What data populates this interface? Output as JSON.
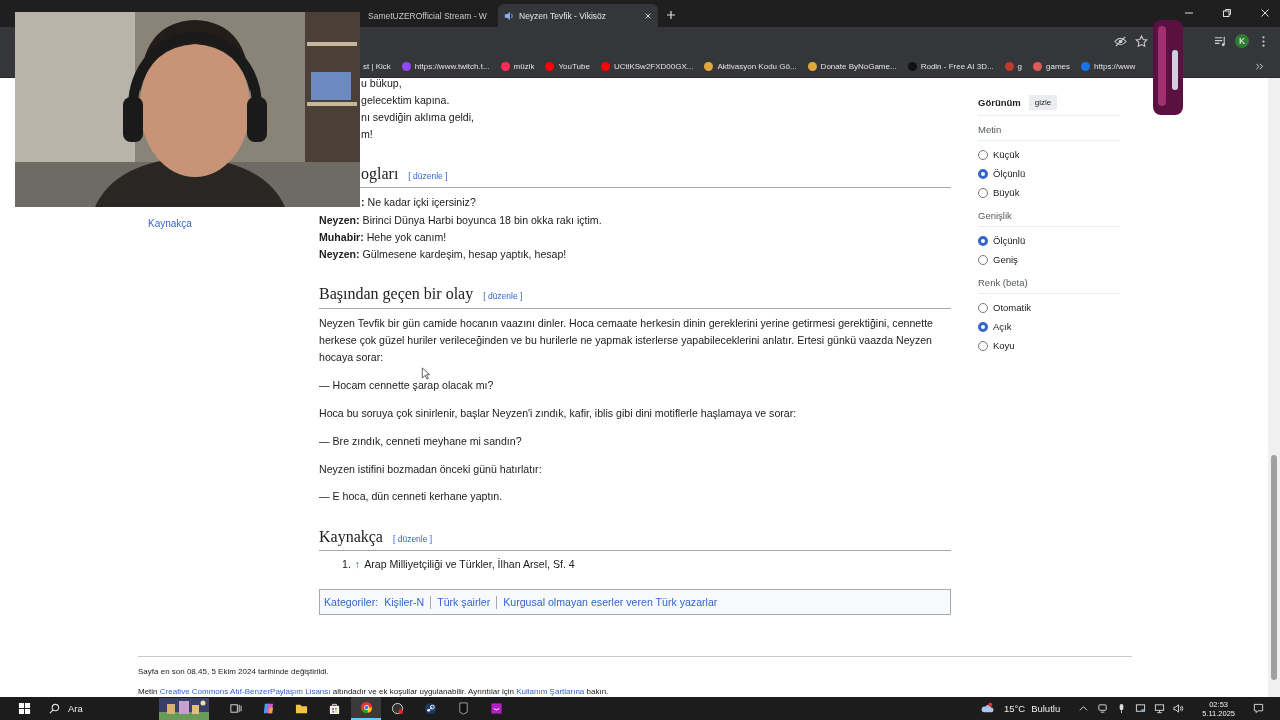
{
  "tabs": [
    {
      "label": "SametUZEROfficial Stream - W",
      "selected": false
    },
    {
      "label": "Neyzen Tevfik - Vikisöz",
      "selected": true
    }
  ],
  "profile_initial": "K",
  "bookmarks": [
    {
      "label": "st | Kick"
    },
    {
      "label": "https://www.twitch.t...",
      "color": "#9146ff"
    },
    {
      "label": "müzik",
      "color": "#ff2d55"
    },
    {
      "label": "YouTube",
      "color": "#ff0000"
    },
    {
      "label": "UCtlKSw2FXD00GX...",
      "color": "#ff0000"
    },
    {
      "label": "Aktivasyon Kodu Gö...",
      "color": "#e0a83a"
    },
    {
      "label": "Donate ByNoGame...",
      "color": "#e0a83a"
    },
    {
      "label": "Rodin - Free AI 3D...",
      "color": "#111111"
    },
    {
      "label": "g",
      "color": "#c0392b"
    },
    {
      "label": "games",
      "color": "#e05a5a"
    },
    {
      "label": "https://www",
      "color": "#1a73e8"
    }
  ],
  "toc": [
    {
      "label": "Kaynakça"
    }
  ],
  "poem_lines": [
    "u bükup,",
    "gelecektim kapına.",
    "nı sevdiğin aklıma geldi,",
    "m!"
  ],
  "sections": [
    {
      "heading": "ogları",
      "edit": "[ düzenle ]",
      "blocks": [
        {
          "kind": "line",
          "text": "**:** Ne kadar içki içersiniz?"
        },
        {
          "kind": "line",
          "text": "**Neyzen:** Birinci Dünya Harbi boyunca 18 bin okka rakı içtim."
        },
        {
          "kind": "line",
          "text": "**Muhabir:** Hehe yok canım!"
        },
        {
          "kind": "line",
          "text": "**Neyzen:** Gülmesene kardeşim, hesap yaptık, hesap!"
        }
      ]
    },
    {
      "heading": "Başından geçen bir olay",
      "edit": "[ düzenle ]",
      "blocks": [
        {
          "kind": "para",
          "text": "Neyzen Tevfik bir gün camide hocanın vaazını dinler. Hoca cemaate herkesin dinin gereklerini yerine getirmesi gerektiğini, cennette herkese çok güzel huriler verileceğinden ve bu hurilerle ne yapmak isterlerse yapabileceklerini anlatır. Ertesi günkü vaazda Neyzen hocaya sorar:"
        },
        {
          "kind": "para",
          "text": "— Hocam cennette şarap olacak mı?"
        },
        {
          "kind": "para",
          "text": "Hoca bu soruya çok sinirlenir, başlar Neyzen'i zındık, kafir, iblis gibi dini motiflerle haşlamaya ve sorar:"
        },
        {
          "kind": "para",
          "text": "— Bre zındık, cenneti meyhane mi sandın?"
        },
        {
          "kind": "para",
          "text": "Neyzen istifini bozmadan önceki günü hatırlatır:"
        },
        {
          "kind": "para",
          "text": "— E hoca, dün cenneti kerhane yaptın."
        }
      ]
    },
    {
      "heading": "Kaynakça",
      "edit": "[ düzenle ]",
      "blocks": [
        {
          "kind": "reference",
          "number": "1.",
          "arrow": "↑",
          "text": "Arap Milliyetçiliği ve Türkler, İlhan Arsel, Sf. 4"
        }
      ]
    }
  ],
  "categories": {
    "label": "Kategoriler:",
    "items": [
      "Kişiler-N",
      "Türk şairler",
      "Kurgusal olmayan eserler veren Türk yazarlar"
    ]
  },
  "appearance": {
    "title": "Görünüm",
    "hide_button": "gizle",
    "groups": [
      {
        "label": "Metin",
        "options": [
          {
            "label": "Küçük",
            "selected": false
          },
          {
            "label": "Ölçünlü",
            "selected": true
          },
          {
            "label": "Büyük",
            "selected": false
          }
        ]
      },
      {
        "label": "Genişlik",
        "options": [
          {
            "label": "Ölçünlü",
            "selected": true
          },
          {
            "label": "Geniş",
            "selected": false
          }
        ]
      },
      {
        "label": "Renk (beta)",
        "options": [
          {
            "label": "Otomatik",
            "selected": false
          },
          {
            "label": "Açık",
            "selected": true
          },
          {
            "label": "Koyu",
            "selected": false
          }
        ]
      }
    ]
  },
  "footer": {
    "last_modified": "Sayfa en son 08.45, 5 Ekim 2024 tarihinde değiştirildi.",
    "license": [
      {
        "kind": "text",
        "text": "Metin "
      },
      {
        "kind": "link",
        "text": "Creative Commons Atıf-BenzerPaylaşım Lisansı"
      },
      {
        "kind": "text",
        "text": " altındadır ve ek koşullar uygulanabilir. Ayrıntılar için "
      },
      {
        "kind": "link",
        "text": "Kullanım Şartlarına"
      },
      {
        "kind": "text",
        "text": " bakın."
      }
    ]
  },
  "taskbar": {
    "search": "Ara",
    "temperature": "15°C",
    "weather": "Bulutlu",
    "time": "02:53",
    "date": "5.11.2025"
  }
}
